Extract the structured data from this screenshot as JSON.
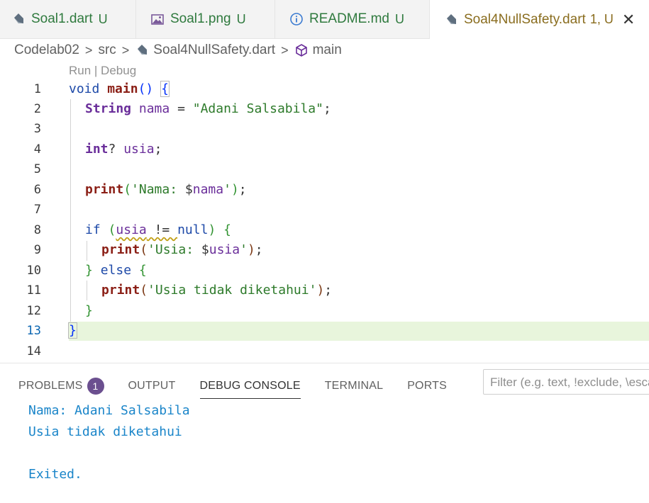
{
  "tabs": [
    {
      "name": "Soal1.dart",
      "status": "U",
      "icon": "dart-icon"
    },
    {
      "name": "Soal1.png",
      "status": "U",
      "icon": "image-icon"
    },
    {
      "name": "README.md",
      "status": "U",
      "icon": "info-icon"
    },
    {
      "name": "Soal4NullSafety.dart",
      "status": "1, U",
      "icon": "dart-icon",
      "close": "✕"
    }
  ],
  "breadcrumb": {
    "items": [
      "Codelab02",
      "src",
      "Soal4NullSafety.dart",
      "main"
    ],
    "separator": ">"
  },
  "editor": {
    "codelens": "Run | Debug",
    "line_numbers": [
      "1",
      "2",
      "3",
      "4",
      "5",
      "6",
      "7",
      "8",
      "9",
      "10",
      "11",
      "12",
      "13",
      "14"
    ],
    "active_line": "13",
    "tokens": {
      "void": "void",
      "main": "main",
      "paren_pair": "()",
      "open_brace": "{",
      "String": "String",
      "nama": "nama",
      "eq": " = ",
      "str_nama": "\"Adani Salsabila\"",
      "semi": ";",
      "int": "int",
      "q": "? ",
      "usia": "usia",
      "print": "print",
      "open_paren": "(",
      "str_nama_pre": "'Nama: ",
      "dollar": "$",
      "str_end": "'",
      "close_paren": ")",
      "if": "if",
      "ne": " != ",
      "null": "null",
      "str_usia_pre": "'Usia: ",
      "else": "else",
      "str_unknown": "'Usia tidak diketahui'",
      "close_brace": "}"
    }
  },
  "panel": {
    "tabs": [
      "PROBLEMS",
      "OUTPUT",
      "DEBUG CONSOLE",
      "TERMINAL",
      "PORTS"
    ],
    "problems_count": "1",
    "active_tab": "DEBUG CONSOLE",
    "filter_placeholder": "Filter (e.g. text, !exclude, \\escape)",
    "console_lines": [
      "Nama: Adani Salsabila",
      "Usia tidak diketahui",
      "",
      "Exited."
    ]
  },
  "colors": {
    "keyword": "#1d49a8",
    "function": "#8b1f16",
    "type": "#6a2e9a",
    "string": "#2d7a2a",
    "console": "#1a85c9",
    "active_tab_text": "#8a6d1f",
    "untracked": "#2f7a3e",
    "line_highlight": "#e8f5dc"
  }
}
